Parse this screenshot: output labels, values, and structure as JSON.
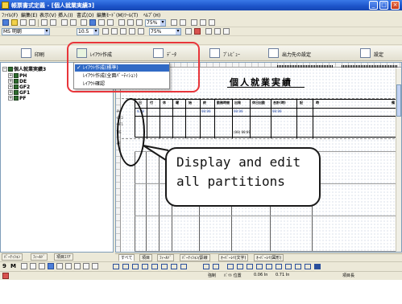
{
  "window": {
    "title": "帳票書式定義 - [個人就業実績3]",
    "min": "_",
    "max": "□",
    "close": "×"
  },
  "menu": [
    "ﾌｧｲﾙ(F)",
    "編集(E)",
    "表示(V)",
    "挿入(I)",
    "書式(O)",
    "編集ﾓｰﾄﾞ(M)",
    "ﾂｰﾙ(T)",
    "ﾍﾙﾌﾟ(H)"
  ],
  "toolbar": {
    "font_name": "MS 明朝",
    "font_size": "10.5",
    "zoom": "75%"
  },
  "ribbon": {
    "print_label": "印刷",
    "layout_label": "ﾚｲｱｳﾄ作成",
    "data_label": "ﾃﾞｰﾀ",
    "preview_label": "ﾌﾟﾚﾋﾞｭｰ",
    "output_label": "出力先の設定",
    "settings_label": "設定"
  },
  "layout_menu": {
    "items": [
      {
        "label": "ﾚｲｱｳﾄ作成(標準)",
        "checked": true
      },
      {
        "label": "ﾚｲｱｳﾄ作成(全面ﾊﾟｰﾃｨｼｮﾝ)",
        "checked": false
      },
      {
        "label": "ﾚｲｱｳﾄ確認",
        "checked": false
      }
    ]
  },
  "tree": {
    "root": "個人就業実績3",
    "children": [
      "PH",
      "DE",
      "GF2",
      "GF1",
      "PF"
    ]
  },
  "tree_tabs": [
    "ﾊﾟｰﾃｨｼｮﾝ",
    "ﾌｨｰﾙﾄﾞ",
    "項目ｴﾘｱ"
  ],
  "canvas": {
    "form_title": "個人就業実績",
    "band_labels": [
      "PH",
      "GF2",
      "GF1",
      "DE",
      "PF"
    ],
    "header_cells": [
      "日",
      "付",
      "休",
      "曜",
      "始",
      "終",
      "勤務時間",
      "出発",
      "休日出勤",
      "合計(時)",
      "記",
      "時",
      "備"
    ],
    "data_cells": [
      "9.99",
      "99:99",
      "99:99",
      "99:99"
    ],
    "sum_label": "(99) 99:99"
  },
  "annotation": {
    "callout": "Display and edit\nall partitions"
  },
  "sheet_tabs": [
    "すべて",
    "項目",
    "ﾌｨｰﾙﾄﾞ",
    "ﾊﾟｰﾃｨｼｮﾝ/罫線",
    "ｵｰﾊﾞｰﾚｲ(文字)",
    "ｵｰﾊﾞｰﾚｲ(図形)"
  ],
  "drawbar": {
    "page": "9",
    "m_label": "M"
  },
  "status": {
    "pos_label": "強制",
    "x_label": "ﾊﾞｲﾄ 位置",
    "x_val": "0.06 In",
    "y_val": "0.71 In",
    "mode": "項目長"
  },
  "colors": {
    "accent": "#316ac5",
    "highlight": "#e8353a",
    "titlebar": "#1c54c9"
  }
}
